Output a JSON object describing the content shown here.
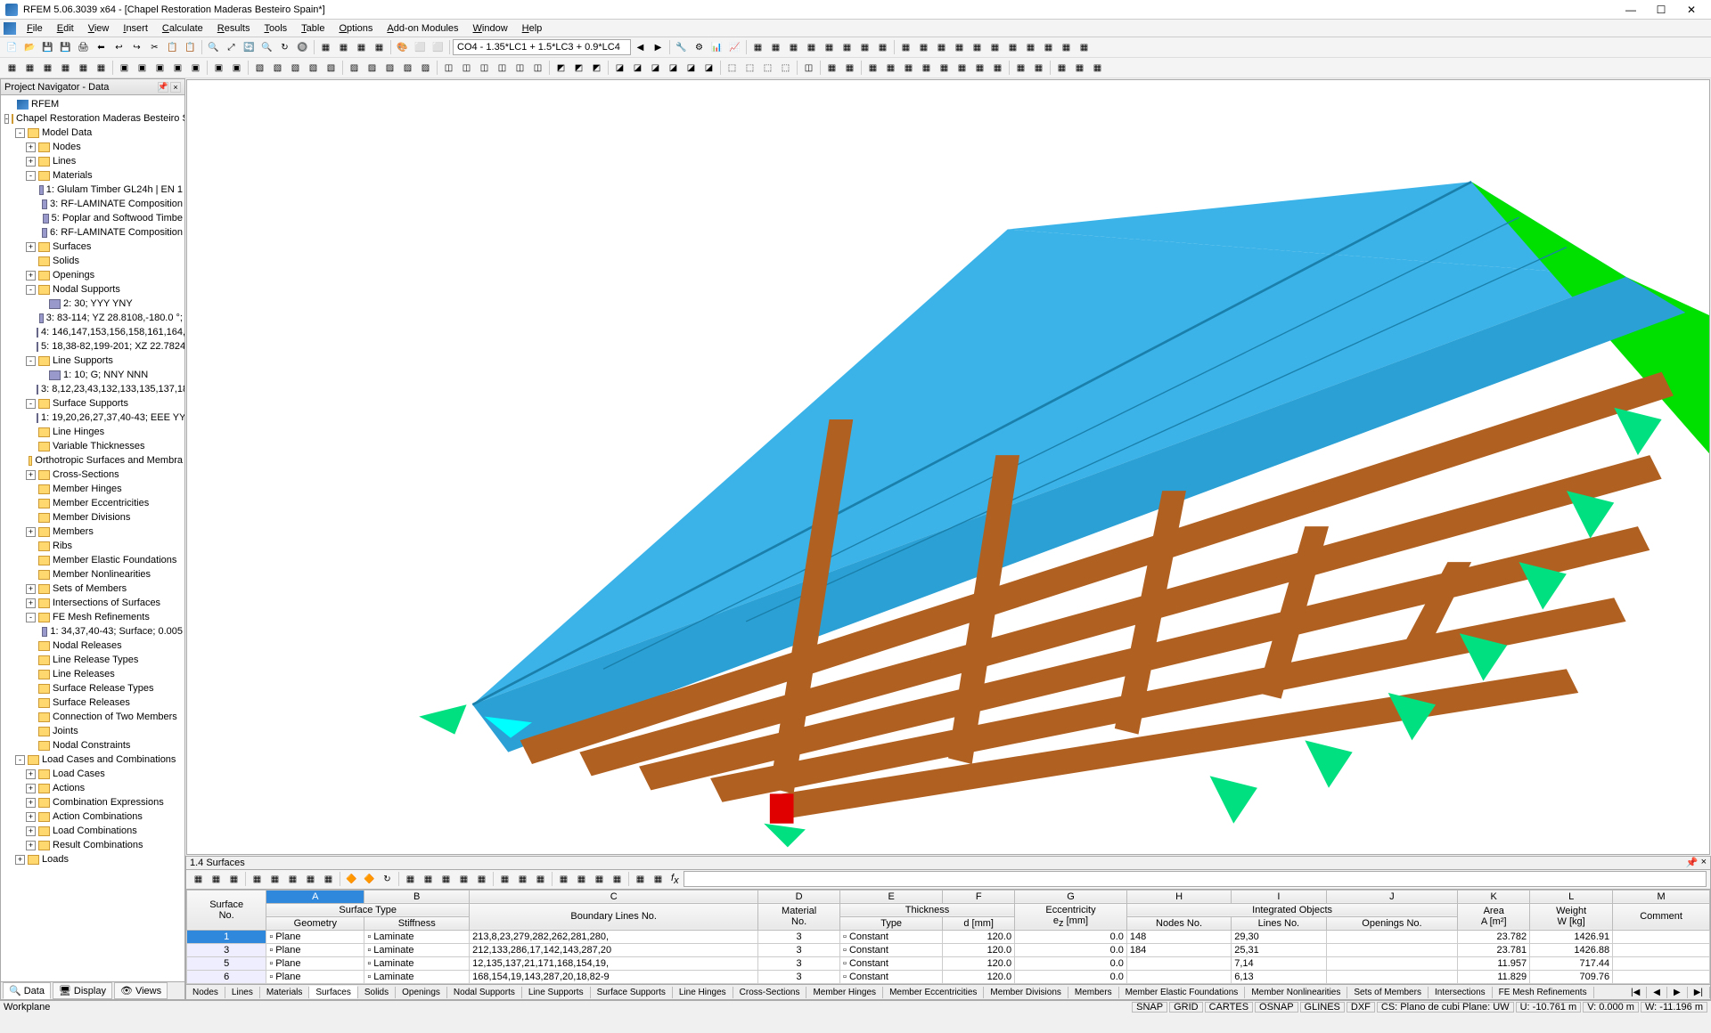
{
  "title": "RFEM 5.06.3039 x64 - [Chapel Restoration Maderas Besteiro Spain*]",
  "menus": [
    "File",
    "Edit",
    "View",
    "Insert",
    "Calculate",
    "Results",
    "Tools",
    "Table",
    "Options",
    "Add-on Modules",
    "Window",
    "Help"
  ],
  "combo_value": "CO4 - 1.35*LC1 + 1.5*LC3 + 0.9*LC4",
  "navigator": {
    "title": "Project Navigator - Data",
    "root": "RFEM",
    "project": "Chapel Restoration Maderas Besteiro Sp",
    "model_data": "Model Data",
    "items": [
      {
        "l": 2,
        "t": "Nodes",
        "i": "f",
        "bx": "+"
      },
      {
        "l": 2,
        "t": "Lines",
        "i": "f",
        "bx": "+"
      },
      {
        "l": 2,
        "t": "Materials",
        "i": "f",
        "bx": "-"
      },
      {
        "l": 3,
        "t": "1: Glulam Timber GL24h | EN 1",
        "i": "m"
      },
      {
        "l": 3,
        "t": "3: RF-LAMINATE Composition",
        "i": "m"
      },
      {
        "l": 3,
        "t": "5: Poplar and Softwood Timbe",
        "i": "m"
      },
      {
        "l": 3,
        "t": "6: RF-LAMINATE Composition",
        "i": "m"
      },
      {
        "l": 2,
        "t": "Surfaces",
        "i": "f",
        "bx": "+"
      },
      {
        "l": 2,
        "t": "Solids",
        "i": "f"
      },
      {
        "l": 2,
        "t": "Openings",
        "i": "f",
        "bx": "+"
      },
      {
        "l": 2,
        "t": "Nodal Supports",
        "i": "f",
        "bx": "-"
      },
      {
        "l": 3,
        "t": "2: 30; YYY YNY",
        "i": "s"
      },
      {
        "l": 3,
        "t": "3: 83-114; YZ 28.8108,-180.0 °;",
        "i": "s"
      },
      {
        "l": 3,
        "t": "4: 146,147,153,156,158,161,164,",
        "i": "s"
      },
      {
        "l": 3,
        "t": "5: 18,38-82,199-201; XZ 22.7824",
        "i": "s"
      },
      {
        "l": 2,
        "t": "Line Supports",
        "i": "f",
        "bx": "-"
      },
      {
        "l": 3,
        "t": "1: 10; G; NNY NNN",
        "i": "s"
      },
      {
        "l": 3,
        "t": "3: 8,12,23,43,132,133,135,137,18",
        "i": "s"
      },
      {
        "l": 2,
        "t": "Surface Supports",
        "i": "f",
        "bx": "-"
      },
      {
        "l": 3,
        "t": "1: 19,20,26,27,37,40-43; EEE YY;",
        "i": "s"
      },
      {
        "l": 2,
        "t": "Line Hinges",
        "i": "f"
      },
      {
        "l": 2,
        "t": "Variable Thicknesses",
        "i": "f"
      },
      {
        "l": 2,
        "t": "Orthotropic Surfaces and Membra",
        "i": "f"
      },
      {
        "l": 2,
        "t": "Cross-Sections",
        "i": "f",
        "bx": "+"
      },
      {
        "l": 2,
        "t": "Member Hinges",
        "i": "f"
      },
      {
        "l": 2,
        "t": "Member Eccentricities",
        "i": "f"
      },
      {
        "l": 2,
        "t": "Member Divisions",
        "i": "f"
      },
      {
        "l": 2,
        "t": "Members",
        "i": "f",
        "bx": "+"
      },
      {
        "l": 2,
        "t": "Ribs",
        "i": "f"
      },
      {
        "l": 2,
        "t": "Member Elastic Foundations",
        "i": "f"
      },
      {
        "l": 2,
        "t": "Member Nonlinearities",
        "i": "f"
      },
      {
        "l": 2,
        "t": "Sets of Members",
        "i": "f",
        "bx": "+"
      },
      {
        "l": 2,
        "t": "Intersections of Surfaces",
        "i": "f",
        "bx": "+"
      },
      {
        "l": 2,
        "t": "FE Mesh Refinements",
        "i": "f",
        "bx": "-"
      },
      {
        "l": 3,
        "t": "1: 34,37,40-43; Surface; 0.005",
        "i": "s"
      },
      {
        "l": 2,
        "t": "Nodal Releases",
        "i": "f"
      },
      {
        "l": 2,
        "t": "Line Release Types",
        "i": "f"
      },
      {
        "l": 2,
        "t": "Line Releases",
        "i": "f"
      },
      {
        "l": 2,
        "t": "Surface Release Types",
        "i": "f"
      },
      {
        "l": 2,
        "t": "Surface Releases",
        "i": "f"
      },
      {
        "l": 2,
        "t": "Connection of Two Members",
        "i": "f"
      },
      {
        "l": 2,
        "t": "Joints",
        "i": "f"
      },
      {
        "l": 2,
        "t": "Nodal Constraints",
        "i": "f"
      }
    ],
    "lc_group": "Load Cases and Combinations",
    "lc_items": [
      {
        "l": 2,
        "t": "Load Cases",
        "i": "f",
        "bx": "+"
      },
      {
        "l": 2,
        "t": "Actions",
        "i": "f",
        "bx": "+"
      },
      {
        "l": 2,
        "t": "Combination Expressions",
        "i": "f",
        "bx": "+"
      },
      {
        "l": 2,
        "t": "Action Combinations",
        "i": "f",
        "bx": "+"
      },
      {
        "l": 2,
        "t": "Load Combinations",
        "i": "f",
        "bx": "+"
      },
      {
        "l": 2,
        "t": "Result Combinations",
        "i": "f",
        "bx": "+"
      }
    ],
    "loads": "Loads",
    "tabs": [
      "Data",
      "Display",
      "Views"
    ]
  },
  "bottom": {
    "title": "1.4 Surfaces",
    "fx": "f<sub>x</sub>",
    "col_letters": [
      "A",
      "B",
      "C",
      "D",
      "E",
      "F",
      "G",
      "H",
      "I",
      "J",
      "K",
      "L",
      "M"
    ],
    "group_headers": {
      "surface": "Surface\nNo.",
      "surface_type": "Surface Type",
      "boundary": "Boundary Lines No.",
      "material": "Material\nNo.",
      "thickness": "Thickness",
      "ecc": "Eccentricity",
      "integrated": "Integrated Objects",
      "area": "Area\nA [m²]",
      "weight": "Weight\nW [kg]",
      "comment": "Comment"
    },
    "sub_headers": {
      "geometry": "Geometry",
      "stiffness": "Stiffness",
      "type": "Type",
      "d": "d [mm]",
      "ez": "e<sub>z</sub> [mm]",
      "nodes": "Nodes No.",
      "lines": "Lines No.",
      "openings": "Openings No."
    },
    "rows": [
      {
        "no": "1",
        "geom": "Plane",
        "stiff": "Laminate",
        "bl": "213,8,23,279,282,262,281,280,",
        "mat": "3",
        "type": "Constant",
        "d": "120.0",
        "ez": "0.0",
        "nodes": "148",
        "lines": "29,30",
        "open": "",
        "area": "23.782",
        "weight": "1426.91",
        "comment": ""
      },
      {
        "no": "3",
        "geom": "Plane",
        "stiff": "Laminate",
        "bl": "212,133,286,17,142,143,287,20",
        "mat": "3",
        "type": "Constant",
        "d": "120.0",
        "ez": "0.0",
        "nodes": "184",
        "lines": "25,31",
        "open": "",
        "area": "23.781",
        "weight": "1426.88",
        "comment": ""
      },
      {
        "no": "5",
        "geom": "Plane",
        "stiff": "Laminate",
        "bl": "12,135,137,21,171,168,154,19,",
        "mat": "3",
        "type": "Constant",
        "d": "120.0",
        "ez": "0.0",
        "nodes": "",
        "lines": "7,14",
        "open": "",
        "area": "11.957",
        "weight": "717.44",
        "comment": ""
      },
      {
        "no": "6",
        "geom": "Plane",
        "stiff": "Laminate",
        "bl": "168,154,19,143,287,20,18,82-9",
        "mat": "3",
        "type": "Constant",
        "d": "120.0",
        "ez": "0.0",
        "nodes": "",
        "lines": "6,13",
        "open": "",
        "area": "11.829",
        "weight": "709.76",
        "comment": ""
      }
    ],
    "tabstrip": [
      "Nodes",
      "Lines",
      "Materials",
      "Surfaces",
      "Solids",
      "Openings",
      "Nodal Supports",
      "Line Supports",
      "Surface Supports",
      "Line Hinges",
      "Cross-Sections",
      "Member Hinges",
      "Member Eccentricities",
      "Member Divisions",
      "Members",
      "Member Elastic Foundations",
      "Member Nonlinearities",
      "Sets of Members",
      "Intersections",
      "FE Mesh Refinements"
    ]
  },
  "statusbar": {
    "left": "Workplane",
    "right": [
      "SNAP",
      "GRID",
      "CARTES",
      "OSNAP",
      "GLINES",
      "DXF",
      "CS: Plano de cubi Plane: UW",
      "U: -10.761 m",
      "V: 0.000 m",
      "W: -11.196 m"
    ]
  }
}
